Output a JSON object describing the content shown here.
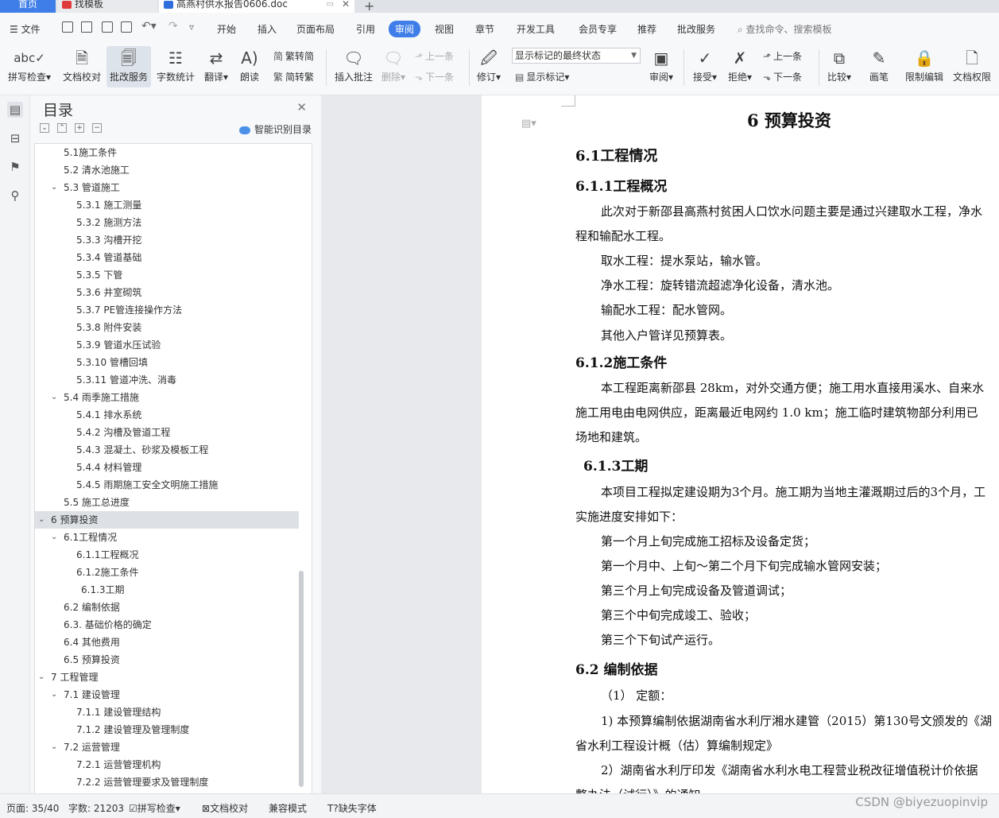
{
  "tabs": {
    "home": "首页",
    "template": "找模板",
    "document": "高燕村供水报告0606.doc",
    "new_tab": "+"
  },
  "menu": {
    "file": "文件",
    "items": [
      "开始",
      "插入",
      "页面布局",
      "引用",
      "审阅",
      "视图",
      "章节",
      "开发工具",
      "会员专享",
      "推荐",
      "批改服务"
    ],
    "active": "审阅",
    "search": "查找命令、搜索模板"
  },
  "ribbon": {
    "spell_check": "拼写检查",
    "doc_proof": "文档校对",
    "correct_service": "批改服务",
    "word_count": "字数统计",
    "translate": "翻译",
    "read_aloud": "朗读",
    "trad_simp": "繁转简",
    "simp_trad": "简转繁",
    "insert_comment": "插入批注",
    "delete": "删除",
    "prev_comment": "上一条",
    "next_comment": "下一条",
    "track": "修订",
    "display_select": "显示标记的最终状态",
    "show_markup": "显示标记",
    "review": "审阅",
    "accept": "接受",
    "reject": "拒绝",
    "prev_change": "上一条",
    "next_change": "下一条",
    "compare": "比较",
    "pen": "画笔",
    "restrict_edit": "限制编辑",
    "doc_permission": "文档权限"
  },
  "toc": {
    "title": "目录",
    "smart_label": "智能识别目录",
    "items": [
      {
        "text": "5.1施工条件",
        "level": 2
      },
      {
        "text": "5.2  清水池施工",
        "level": 2
      },
      {
        "text": "5.3  管道施工",
        "level": 2,
        "expanded": true
      },
      {
        "text": "5.3.1  施工测量",
        "level": 3
      },
      {
        "text": "5.3.2  施测方法",
        "level": 3
      },
      {
        "text": "5.3.3  沟槽开挖",
        "level": 3
      },
      {
        "text": "5.3.4  管道基础",
        "level": 3
      },
      {
        "text": "5.3.5  下管",
        "level": 3
      },
      {
        "text": "5.3.6  井室砌筑",
        "level": 3
      },
      {
        "text": "5.3.7    PE管连接操作方法",
        "level": 3
      },
      {
        "text": "5.3.8  附件安装",
        "level": 3
      },
      {
        "text": "5.3.9  管道水压试验",
        "level": 3
      },
      {
        "text": "5.3.10  管槽回填",
        "level": 3
      },
      {
        "text": "5.3.11  管道冲洗、消毒",
        "level": 3
      },
      {
        "text": "5.4  雨季施工措施",
        "level": 2,
        "expanded": true
      },
      {
        "text": "5.4.1  排水系统",
        "level": 3
      },
      {
        "text": "5.4.2  沟槽及管道工程",
        "level": 3
      },
      {
        "text": "5.4.3  混凝土、砂浆及模板工程",
        "level": 3
      },
      {
        "text": "5.4.4  材料管理",
        "level": 3
      },
      {
        "text": "5.4.5  雨期施工安全文明施工措施",
        "level": 3
      },
      {
        "text": "5.5  施工总进度",
        "level": 2
      },
      {
        "text": "6  预算投资",
        "level": 1,
        "expanded": true,
        "highlight": true
      },
      {
        "text": "6.1工程情况",
        "level": 2,
        "expanded": true
      },
      {
        "text": "6.1.1工程概况",
        "level": 3
      },
      {
        "text": "6.1.2施工条件",
        "level": 3
      },
      {
        "text": "6.1.3工期",
        "level": 3,
        "indent_extra": true
      },
      {
        "text": "6.2  编制依据",
        "level": 2
      },
      {
        "text": "6.3.  基础价格的确定",
        "level": 2
      },
      {
        "text": "6.4  其他费用",
        "level": 2
      },
      {
        "text": "6.5  预算投资",
        "level": 2
      },
      {
        "text": "7  工程管理",
        "level": 1,
        "expanded": true
      },
      {
        "text": "7.1  建设管理",
        "level": 2,
        "expanded": true
      },
      {
        "text": "7.1.1  建设管理结构",
        "level": 3
      },
      {
        "text": "7.1.2  建设管理及管理制度",
        "level": 3
      },
      {
        "text": "7.2  运营管理",
        "level": 2,
        "expanded": true
      },
      {
        "text": "7.2.1  运营管理机构",
        "level": 3
      },
      {
        "text": "7.2.2  运营管理要求及管理制度",
        "level": 3
      }
    ]
  },
  "document": {
    "lines": [
      {
        "text": "6  预算投资",
        "style": "h1",
        "indent": 0
      },
      {
        "text": "6.1工程情况",
        "style": "h2",
        "indent": 0
      },
      {
        "text": "6.1.1工程概况",
        "style": "h3",
        "indent": 0
      },
      {
        "text": "此次对于新邵县高燕村贫困人口饮水问题主要是通过兴建取水工程，净水",
        "style": "p",
        "indent": 1
      },
      {
        "text": "程和输配水工程。",
        "style": "p",
        "indent": 0
      },
      {
        "text": "取水工程：提水泵站，输水管。",
        "style": "p",
        "indent": 1
      },
      {
        "text": "净水工程：旋转错流超滤净化设备，清水池。",
        "style": "p",
        "indent": 1
      },
      {
        "text": "输配水工程：配水管网。",
        "style": "p",
        "indent": 1
      },
      {
        "text": "其他入户管详见预算表。",
        "style": "p",
        "indent": 1
      },
      {
        "text": "6.1.2施工条件",
        "style": "h3",
        "indent": 0
      },
      {
        "text": "本工程距离新邵县 28km，对外交通方便；施工用水直接用溪水、自来水",
        "style": "p",
        "indent": 1
      },
      {
        "text": "施工用电由电网供应，距离最近电网约 1.0 km；施工临时建筑物部分利用已",
        "style": "p",
        "indent": 0
      },
      {
        "text": "场地和建筑。",
        "style": "p",
        "indent": 0
      },
      {
        "text": "6.1.3工期",
        "style": "h3",
        "indent": 2
      },
      {
        "text": "本项目工程拟定建设期为3个月。施工期为当地主灌溉期过后的3个月，工",
        "style": "p",
        "indent": 1
      },
      {
        "text": "实施进度安排如下：",
        "style": "p",
        "indent": 0
      },
      {
        "text": "第一个月上旬完成施工招标及设备定货；",
        "style": "p",
        "indent": 1
      },
      {
        "text": "第一个月中、上旬～第二个月下旬完成输水管网安装；",
        "style": "p",
        "indent": 1
      },
      {
        "text": "第三个月上旬完成设备及管道调试；",
        "style": "p",
        "indent": 1
      },
      {
        "text": "第三个中旬完成竣工、验收；",
        "style": "p",
        "indent": 1
      },
      {
        "text": "第三个下旬试产运行。",
        "style": "p",
        "indent": 1
      },
      {
        "text": "6.2  编制依据",
        "style": "h3",
        "indent": 0
      },
      {
        "text": "（1）  定额：",
        "style": "p",
        "indent": 1
      },
      {
        "text": "1) 本预算编制依据湖南省水利厅湘水建管（2015）第130号文颁发的《湖",
        "style": "p",
        "indent": 1
      },
      {
        "text": "省水利工程设计概（估）算编制规定》",
        "style": "p",
        "indent": 0
      },
      {
        "text": "2）湖南省水利厅印发《湖南省水利水电工程营业税改征增值税计价依据",
        "style": "p",
        "indent": 1
      },
      {
        "text": "整办法（试行）》的通知",
        "style": "p",
        "indent": 0
      }
    ]
  },
  "status": {
    "page": "页面: 35/40",
    "words": "字数: 21203",
    "spell": "拼写检查",
    "proof": "文档校对",
    "compat": "兼容模式",
    "missing_font": "缺失字体"
  },
  "watermark": "CSDN @biyezuopinvip",
  "colors": {
    "accent": "#3f7ee8",
    "toc_highlight": "#dde1e6",
    "doc_bg": "#e8e9ec"
  }
}
